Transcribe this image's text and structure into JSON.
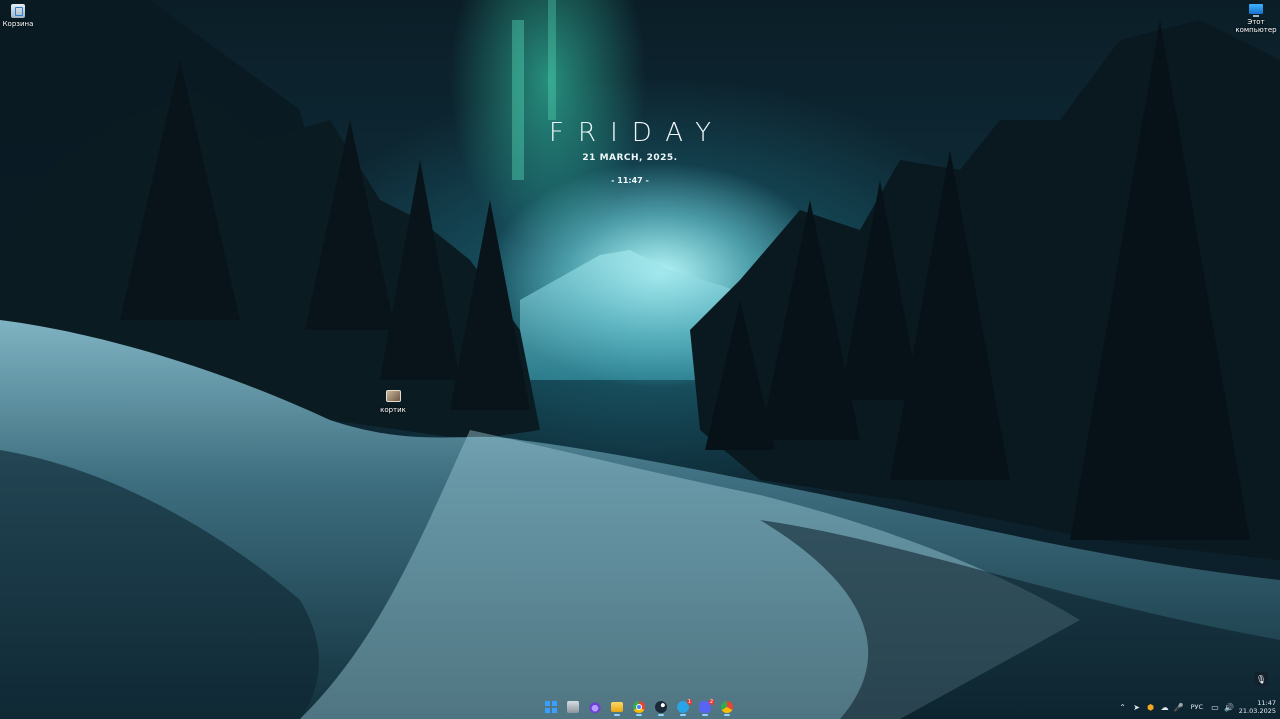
{
  "desktop": {
    "icons": [
      {
        "name": "recycle-bin",
        "label": "Корзина"
      },
      {
        "name": "this-pc",
        "label": "Этот компьютер"
      },
      {
        "name": "kortik",
        "label": "кортик"
      }
    ]
  },
  "widget": {
    "day": "FRIDAY",
    "date": "21 MARCH, 2025.",
    "time": "- 11:47 -"
  },
  "taskbar": {
    "apps": [
      {
        "name": "start",
        "icon": "windows-icon"
      },
      {
        "name": "task-view",
        "icon": "task-view-icon"
      },
      {
        "name": "tor-browser",
        "icon": "tor-icon"
      },
      {
        "name": "file-explorer",
        "icon": "folder-icon"
      },
      {
        "name": "chrome",
        "icon": "chrome-icon"
      },
      {
        "name": "steam",
        "icon": "steam-icon"
      },
      {
        "name": "telegram",
        "icon": "telegram-icon",
        "badge": "1"
      },
      {
        "name": "discord",
        "icon": "discord-icon",
        "badge": "2"
      },
      {
        "name": "chrome-profile",
        "icon": "chrome-icon"
      }
    ],
    "tray": {
      "language": "РУС",
      "time": "11:47",
      "date": "21.03.2025"
    }
  },
  "colors": {
    "accent_aurora": "#3ce6be",
    "sky": "#0b1e28",
    "snow": "#c8e6ee"
  }
}
